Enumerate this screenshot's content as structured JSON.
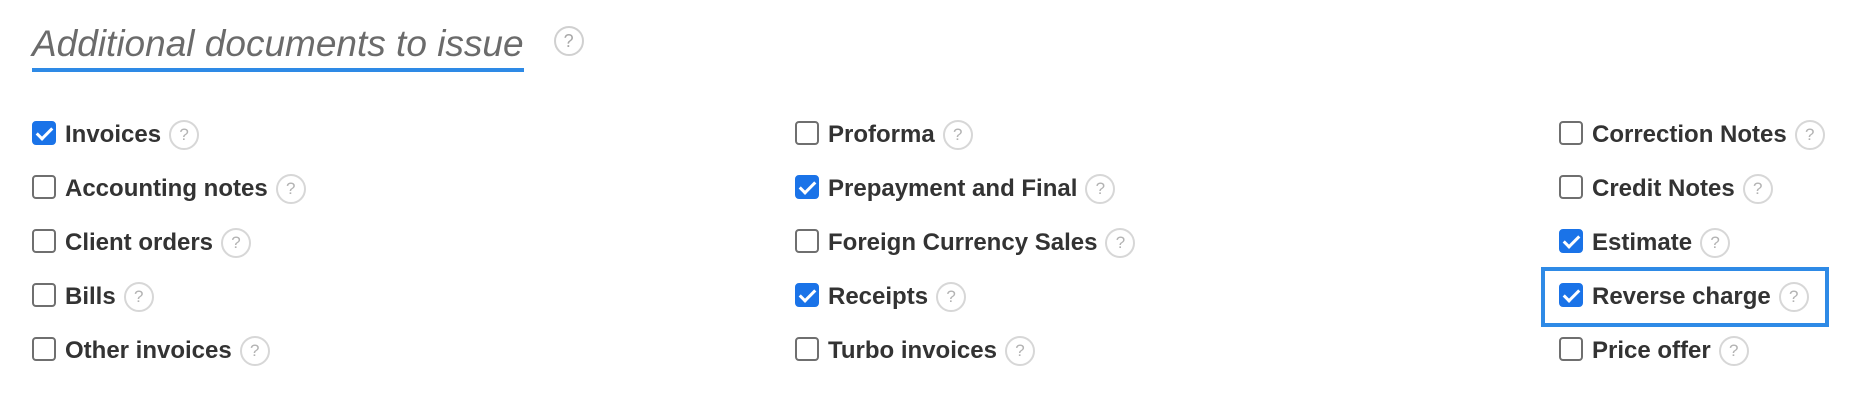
{
  "section": {
    "title": "Additional documents to issue",
    "help": "?"
  },
  "columns": [
    {
      "options": [
        {
          "label": "Invoices",
          "checked": true,
          "help": "?"
        },
        {
          "label": "Accounting notes",
          "checked": false,
          "help": "?"
        },
        {
          "label": "Client orders",
          "checked": false,
          "help": "?"
        },
        {
          "label": "Bills",
          "checked": false,
          "help": "?"
        },
        {
          "label": "Other invoices",
          "checked": false,
          "help": "?"
        }
      ]
    },
    {
      "options": [
        {
          "label": "Proforma",
          "checked": false,
          "help": "?"
        },
        {
          "label": "Prepayment and Final",
          "checked": true,
          "help": "?"
        },
        {
          "label": "Foreign Currency Sales",
          "checked": false,
          "help": "?"
        },
        {
          "label": "Receipts",
          "checked": true,
          "help": "?"
        },
        {
          "label": "Turbo invoices",
          "checked": false,
          "help": "?"
        }
      ]
    },
    {
      "options": [
        {
          "label": "Correction Notes",
          "checked": false,
          "help": "?"
        },
        {
          "label": "Credit Notes",
          "checked": false,
          "help": "?"
        },
        {
          "label": "Estimate",
          "checked": true,
          "help": "?"
        },
        {
          "label": "Reverse charge",
          "checked": true,
          "focused": true,
          "help": "?"
        },
        {
          "label": "Price offer",
          "checked": false,
          "help": "?"
        }
      ]
    }
  ],
  "colors": {
    "accent": "#1a73e8",
    "underline": "#2e8ae6",
    "text": "#333333",
    "title": "#6b6b6b"
  }
}
